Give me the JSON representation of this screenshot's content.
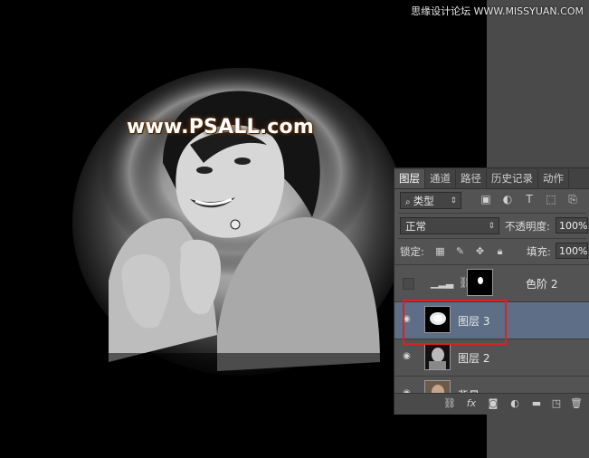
{
  "watermark_top": "思缘设计论坛 WWW.MISSYUAN.COM",
  "site_watermark": "www.PSALL.com",
  "panel": {
    "tabs": [
      "图层",
      "通道",
      "路径",
      "历史记录",
      "动作"
    ],
    "active_tab": "图层",
    "filter_select": "类型",
    "blend_mode": "正常",
    "opacity_label": "不透明度:",
    "opacity_value": "100%",
    "lock_label": "锁定:",
    "fill_label": "填充:",
    "fill_value": "100%",
    "layers": [
      {
        "name": "色阶 2",
        "visible": false,
        "type": "adjustment"
      },
      {
        "name": "图层 3",
        "visible": true,
        "selected": true
      },
      {
        "name": "图层 2",
        "visible": true
      },
      {
        "name": "背景",
        "visible": true
      }
    ],
    "bottom_icons": [
      "link-icon",
      "fx-icon",
      "mask-icon",
      "adjustment-icon",
      "folder-icon",
      "new-layer-icon",
      "trash-icon"
    ]
  },
  "colors": {
    "panel_bg": "#535353",
    "selected_layer": "#5d6e86",
    "highlight_box": "#e02020"
  }
}
